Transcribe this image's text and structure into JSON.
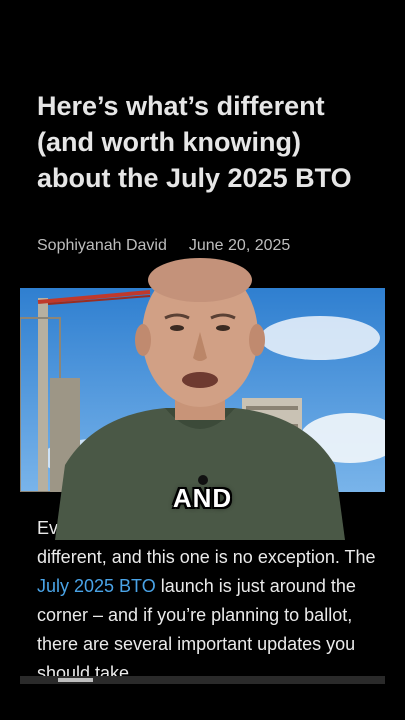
{
  "article": {
    "title": "Here’s what’s different (and worth knowing) about the July 2025 BTO",
    "author": "Sophiyanah David",
    "date": "June 20, 2025",
    "body_before_link": "Every BTO launch is just a little bit different, and this one is no exception. The ",
    "body_link": "July 2025 BTO",
    "body_after_link": " launch is just around the corner – and if you’re planning to ballot, there are several important updates you should take"
  },
  "video": {
    "caption": "AND"
  },
  "colors": {
    "background": "#000000",
    "link": "#4aa3e6",
    "sky": "#3f8fd8",
    "crane": "#c0392b"
  }
}
